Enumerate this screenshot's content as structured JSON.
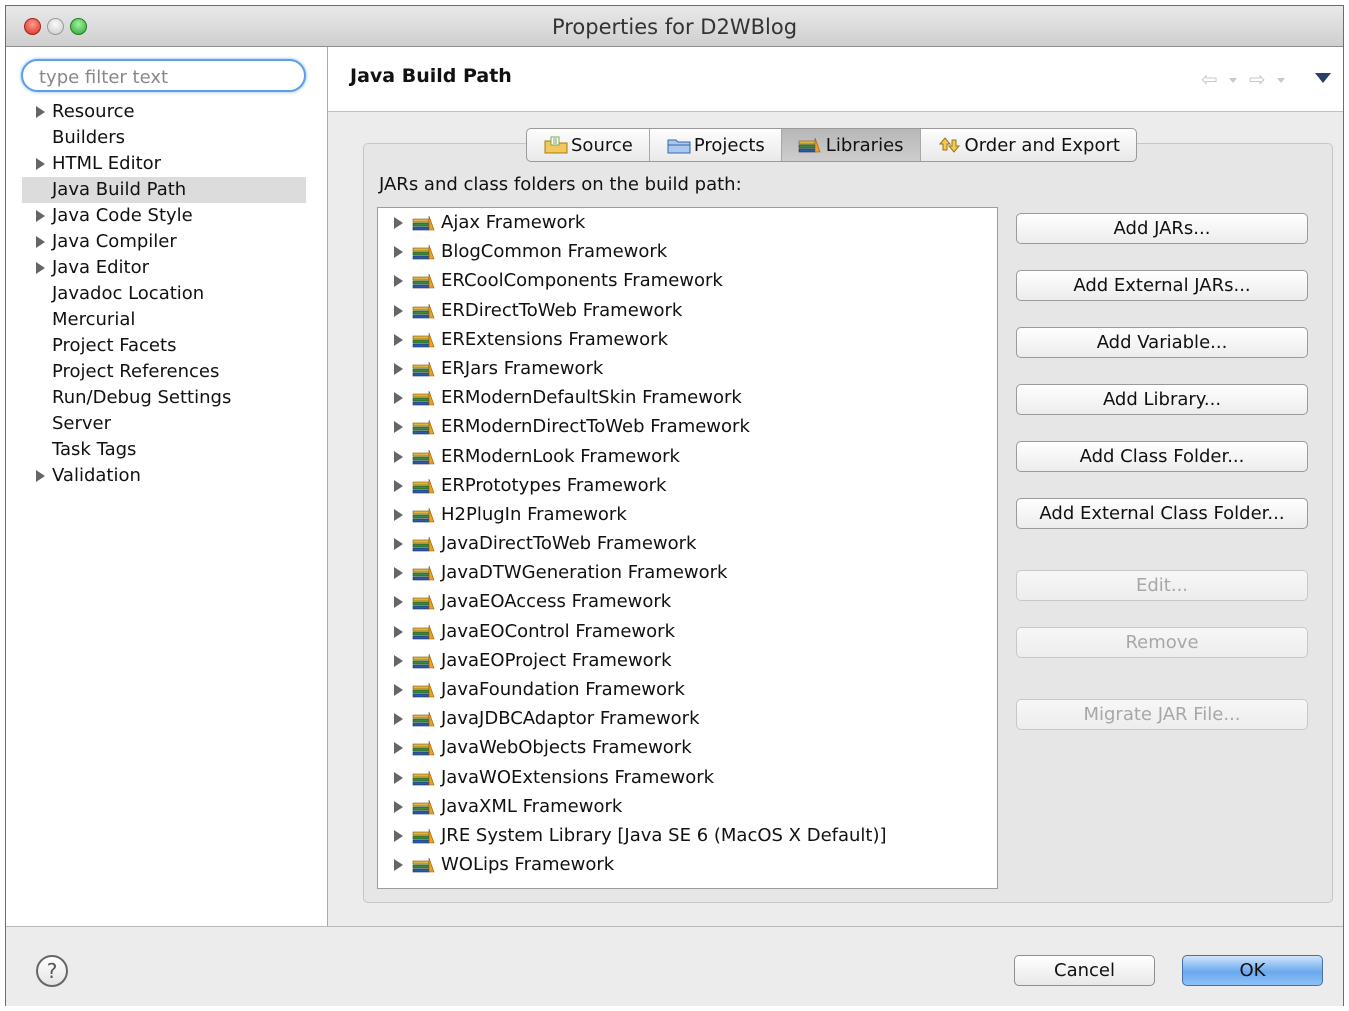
{
  "window": {
    "title": "Properties for D2WBlog"
  },
  "filter": {
    "placeholder": "type filter text",
    "value": ""
  },
  "nav": {
    "items": [
      {
        "label": "Resource",
        "expandable": true
      },
      {
        "label": "Builders",
        "expandable": false
      },
      {
        "label": "HTML Editor",
        "expandable": true
      },
      {
        "label": "Java Build Path",
        "expandable": false,
        "selected": true
      },
      {
        "label": "Java Code Style",
        "expandable": true
      },
      {
        "label": "Java Compiler",
        "expandable": true
      },
      {
        "label": "Java Editor",
        "expandable": true
      },
      {
        "label": "Javadoc Location",
        "expandable": false
      },
      {
        "label": "Mercurial",
        "expandable": false
      },
      {
        "label": "Project Facets",
        "expandable": false
      },
      {
        "label": "Project References",
        "expandable": false
      },
      {
        "label": "Run/Debug Settings",
        "expandable": false
      },
      {
        "label": "Server",
        "expandable": false
      },
      {
        "label": "Task Tags",
        "expandable": false
      },
      {
        "label": "Validation",
        "expandable": true
      }
    ]
  },
  "page": {
    "title": "Java Build Path"
  },
  "tabs": [
    {
      "label": "Source",
      "icon": "source-folder-icon"
    },
    {
      "label": "Projects",
      "icon": "projects-folder-icon"
    },
    {
      "label": "Libraries",
      "icon": "libraries-icon",
      "active": true
    },
    {
      "label": "Order and Export",
      "icon": "order-export-icon"
    }
  ],
  "libraries": {
    "label": "JARs and class folders on the build path:",
    "items": [
      "Ajax Framework",
      "BlogCommon Framework",
      "ERCoolComponents Framework",
      "ERDirectToWeb Framework",
      "ERExtensions Framework",
      "ERJars Framework",
      "ERModernDefaultSkin Framework",
      "ERModernDirectToWeb Framework",
      "ERModernLook Framework",
      "ERPrototypes Framework",
      "H2PlugIn Framework",
      "JavaDirectToWeb Framework",
      "JavaDTWGeneration Framework",
      "JavaEOAccess Framework",
      "JavaEOControl Framework",
      "JavaEOProject Framework",
      "JavaFoundation Framework",
      "JavaJDBCAdaptor Framework",
      "JavaWebObjects Framework",
      "JavaWOExtensions Framework",
      "JavaXML Framework",
      "JRE System Library [Java SE 6 (MacOS X Default)]",
      "WOLips Framework"
    ]
  },
  "buttons": {
    "add_jars": "Add JARs...",
    "add_external_jars": "Add External JARs...",
    "add_variable": "Add Variable...",
    "add_library": "Add Library...",
    "add_class_folder": "Add Class Folder...",
    "add_external_class_folder": "Add External Class Folder...",
    "edit": "Edit...",
    "remove": "Remove",
    "migrate_jar": "Migrate JAR File..."
  },
  "footer": {
    "help": "?",
    "cancel": "Cancel",
    "ok": "OK"
  }
}
